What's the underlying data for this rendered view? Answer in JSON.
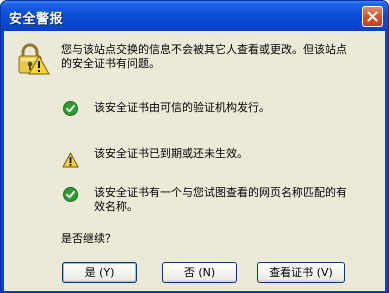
{
  "window": {
    "title": "安全警报"
  },
  "message": {
    "line1": "您与该站点交换的信息不会被其它人查看或更改。但该站点",
    "line2": "的安全证书有问题。"
  },
  "checks": [
    {
      "status": "ok",
      "icon": "green-check-icon",
      "text": "该安全证书由可信的验证机构发行。"
    },
    {
      "status": "warning",
      "icon": "warning-icon",
      "text": "该安全证书已到期或还未生效。"
    },
    {
      "status": "ok",
      "icon": "green-check-icon",
      "text_line1": "该安全证书有一个与您试图查看的网页名称匹配的有",
      "text_line2": "效名称。"
    }
  ],
  "prompt": "是否继续？",
  "buttons": {
    "yes": "是 (Y)",
    "no": "否 (N)",
    "view_cert": "查看证书 (V)"
  },
  "colors": {
    "title_bar": "#0a47cf",
    "dialog_bg": "#ece9d8",
    "ok_green": "#2f9a2f",
    "warning_yellow": "#f7d33a"
  }
}
